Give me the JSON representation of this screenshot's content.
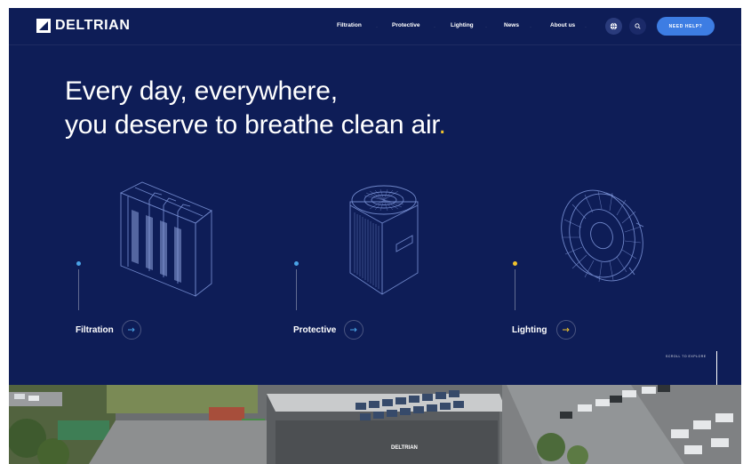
{
  "header": {
    "brand": "DELTRIAN",
    "menu": [
      "Filtration",
      "Protective",
      "Lighting",
      "News",
      "About us"
    ],
    "help_label": "NEED HELP?",
    "globe_icon": "globe-icon",
    "search_icon": "search-icon"
  },
  "hero": {
    "headline_line1": "Every day, everywhere,",
    "headline_line2": "you deserve to breathe clean air",
    "headline_dot": ".",
    "accent_color": "#f0c22d",
    "background_color": "#0e1d57"
  },
  "categories": [
    {
      "label": "Filtration",
      "marker_color": "#4aa3e6",
      "icon": "bag-filter-icon"
    },
    {
      "label": "Protective",
      "marker_color": "#4aa3e6",
      "icon": "air-purifier-icon"
    },
    {
      "label": "Lighting",
      "marker_color": "#f0c22d",
      "icon": "highbay-light-icon"
    }
  ],
  "scroll_label": "SCROLL TO EXPLORE",
  "photo": {
    "building_sign": "DELTRIAN"
  }
}
